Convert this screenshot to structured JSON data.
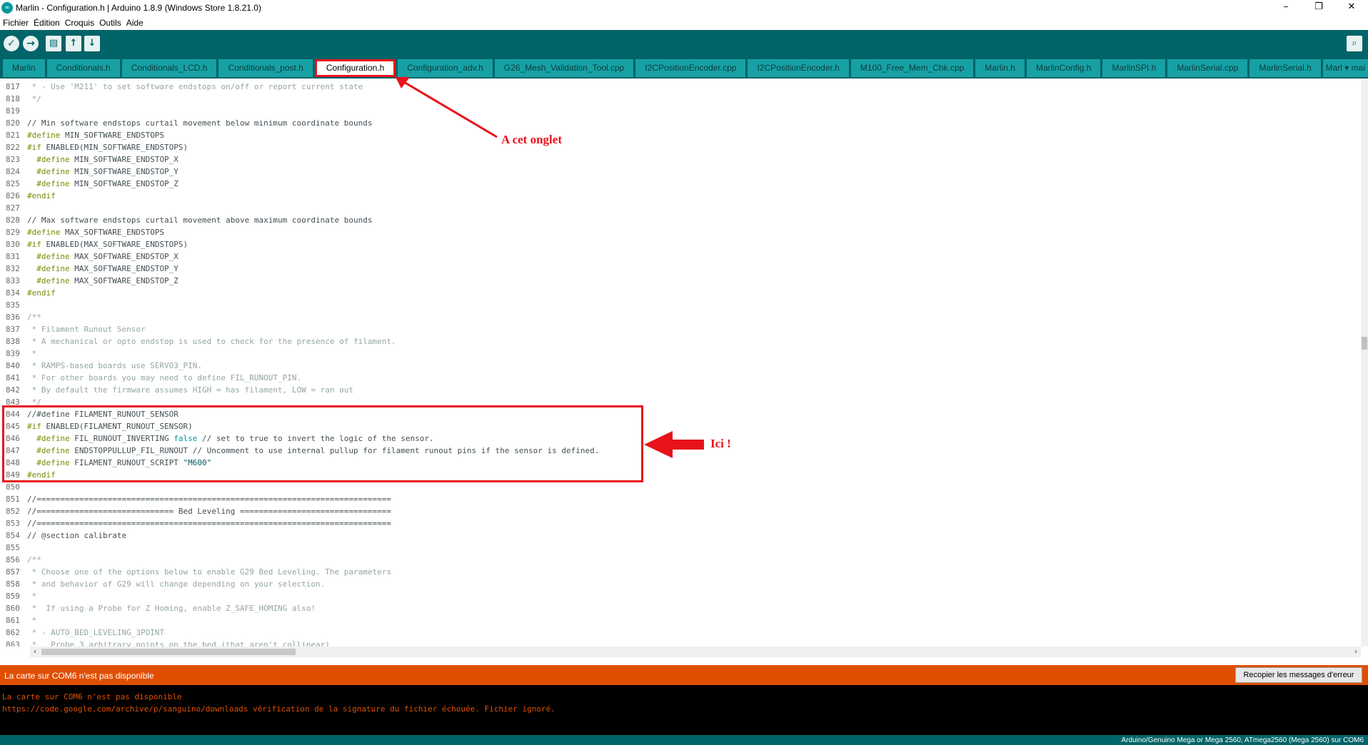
{
  "window": {
    "title": "Marlin - Configuration.h | Arduino 1.8.9 (Windows Store 1.8.21.0)",
    "app_icon": "∞",
    "minimize": "–",
    "maximize": "❐",
    "close": "✕"
  },
  "menu": [
    "Fichier",
    "Édition",
    "Croquis",
    "Outils",
    "Aide"
  ],
  "toolbar": {
    "verify_icon": "✓",
    "upload_icon": "→",
    "new_icon": "▤",
    "open_icon": "↑",
    "save_icon": "↓",
    "serial_icon": "⌕"
  },
  "tabs": [
    "Marlin",
    "Conditionals.h",
    "Conditionals_LCD.h",
    "Conditionals_post.h",
    "Configuration.h",
    "Configuration_adv.h",
    "G26_Mesh_Validation_Tool.cpp",
    "I2CPositionEncoder.cpp",
    "I2CPositionEncoder.h",
    "M100_Free_Mem_Chk.cpp",
    "Marlin.h",
    "MarlinConfig.h",
    "MarlinSPI.h",
    "MarlinSerial.cpp",
    "MarlinSerial.h"
  ],
  "active_tab": "Configuration.h",
  "tab_overflow": "Marl ▾ mai",
  "code": [
    {
      "n": "817",
      "t": " * - Use 'M211' to set software endstops on/off or report current state",
      "c": "cm"
    },
    {
      "n": "818",
      "t": " */",
      "c": "cm"
    },
    {
      "n": "819",
      "t": "",
      "c": "tx"
    },
    {
      "n": "820",
      "t": "// Min software endstops curtail movement below minimum coordinate bounds",
      "c": "tx"
    },
    {
      "n": "821",
      "pre": "#define",
      "t": " MIN_SOFTWARE_ENDSTOPS",
      "c": "tx"
    },
    {
      "n": "822",
      "pre": "#if",
      "t": " ENABLED(MIN_SOFTWARE_ENDSTOPS)",
      "c": "tx"
    },
    {
      "n": "823",
      "indent": "  ",
      "pre": "#define",
      "t": " MIN_SOFTWARE_ENDSTOP_X",
      "c": "tx"
    },
    {
      "n": "824",
      "indent": "  ",
      "pre": "#define",
      "t": " MIN_SOFTWARE_ENDSTOP_Y",
      "c": "tx"
    },
    {
      "n": "825",
      "indent": "  ",
      "pre": "#define",
      "t": " MIN_SOFTWARE_ENDSTOP_Z",
      "c": "tx"
    },
    {
      "n": "826",
      "pre": "#endif",
      "t": "",
      "c": "tx"
    },
    {
      "n": "827",
      "t": "",
      "c": "tx"
    },
    {
      "n": "828",
      "t": "// Max software endstops curtail movement above maximum coordinate bounds",
      "c": "tx"
    },
    {
      "n": "829",
      "pre": "#define",
      "t": " MAX_SOFTWARE_ENDSTOPS",
      "c": "tx"
    },
    {
      "n": "830",
      "pre": "#if",
      "t": " ENABLED(MAX_SOFTWARE_ENDSTOPS)",
      "c": "tx"
    },
    {
      "n": "831",
      "indent": "  ",
      "pre": "#define",
      "t": " MAX_SOFTWARE_ENDSTOP_X",
      "c": "tx"
    },
    {
      "n": "832",
      "indent": "  ",
      "pre": "#define",
      "t": " MAX_SOFTWARE_ENDSTOP_Y",
      "c": "tx"
    },
    {
      "n": "833",
      "indent": "  ",
      "pre": "#define",
      "t": " MAX_SOFTWARE_ENDSTOP_Z",
      "c": "tx"
    },
    {
      "n": "834",
      "pre": "#endif",
      "t": "",
      "c": "tx"
    },
    {
      "n": "835",
      "t": "",
      "c": "tx"
    },
    {
      "n": "836",
      "t": "/**",
      "c": "cm"
    },
    {
      "n": "837",
      "t": " * Filament Runout Sensor",
      "c": "cm"
    },
    {
      "n": "838",
      "t": " * A mechanical or opto endstop is used to check for the presence of filament.",
      "c": "cm"
    },
    {
      "n": "839",
      "t": " *",
      "c": "cm"
    },
    {
      "n": "840",
      "t": " * RAMPS-based boards use SERVO3_PIN.",
      "c": "cm"
    },
    {
      "n": "841",
      "t": " * For other boards you may need to define FIL_RUNOUT_PIN.",
      "c": "cm"
    },
    {
      "n": "842",
      "t": " * By default the firmware assumes HIGH = has filament, LOW = ran out",
      "c": "cm"
    },
    {
      "n": "843",
      "t": " */",
      "c": "cm"
    },
    {
      "n": "844",
      "t": "//#define FILAMENT_RUNOUT_SENSOR",
      "c": "tx"
    },
    {
      "n": "845",
      "pre": "#if",
      "t": " ENABLED(FILAMENT_RUNOUT_SENSOR)",
      "c": "tx"
    },
    {
      "n": "846",
      "indent": "  ",
      "pre": "#define",
      "t": " FIL_RUNOUT_INVERTING ",
      "kw": "false",
      "post": " // set to true to invert the logic of the sensor.",
      "c": "tx"
    },
    {
      "n": "847",
      "indent": "  ",
      "pre": "#define",
      "t": " ENDSTOPPULLUP_FIL_RUNOUT // Uncomment to use internal pullup for filament runout pins if the sensor is defined.",
      "c": "tx"
    },
    {
      "n": "848",
      "indent": "  ",
      "pre": "#define",
      "t": " FILAMENT_RUNOUT_SCRIPT ",
      "str": "\"M600\"",
      "c": "tx"
    },
    {
      "n": "849",
      "pre": "#endif",
      "t": "",
      "c": "tx"
    },
    {
      "n": "850",
      "t": "",
      "c": "tx"
    },
    {
      "n": "851",
      "t": "//===========================================================================",
      "c": "tx"
    },
    {
      "n": "852",
      "t": "//============================= Bed Leveling ================================",
      "c": "tx"
    },
    {
      "n": "853",
      "t": "//===========================================================================",
      "c": "tx"
    },
    {
      "n": "854",
      "t": "// @section calibrate",
      "c": "tx"
    },
    {
      "n": "855",
      "t": "",
      "c": "tx"
    },
    {
      "n": "856",
      "t": "/**",
      "c": "cm"
    },
    {
      "n": "857",
      "t": " * Choose one of the options below to enable G29 Bed Leveling. The parameters",
      "c": "cm"
    },
    {
      "n": "858",
      "t": " * and behavior of G29 will change depending on your selection.",
      "c": "cm"
    },
    {
      "n": "859",
      "t": " *",
      "c": "cm"
    },
    {
      "n": "860",
      "t": " *  If using a Probe for Z Homing, enable Z_SAFE_HOMING also!",
      "c": "cm"
    },
    {
      "n": "861",
      "t": " *",
      "c": "cm"
    },
    {
      "n": "862",
      "t": " * - AUTO_BED_LEVELING_3POINT",
      "c": "cm"
    },
    {
      "n": "863",
      "t": " *   Probe 3 arbitrary points on the bed (that aren't collinear)",
      "c": "cm"
    }
  ],
  "scroll": {
    "left_arrow": "‹",
    "right_arrow": "›"
  },
  "status": {
    "message": "La carte sur COM6 n'est pas disponible",
    "copy_button": "Recopier les messages d'erreur"
  },
  "console": [
    "La carte sur COM6 n'est pas disponible",
    "https://code.google.com/archive/p/sanguino/downloads vérification de la signature du fichier échouée. Fichier ignoré."
  ],
  "board": "Arduino/Genuino Mega or Mega 2560, ATmega2560 (Mega 2560) sur COM6",
  "annotations": {
    "tab_note": "A cet onglet",
    "code_note": "Ici !"
  },
  "colors": {
    "teal_dark": "#006468",
    "teal_tab": "#17a1a5",
    "status_orange": "#e04f00",
    "annotation_red": "#e8121b"
  }
}
